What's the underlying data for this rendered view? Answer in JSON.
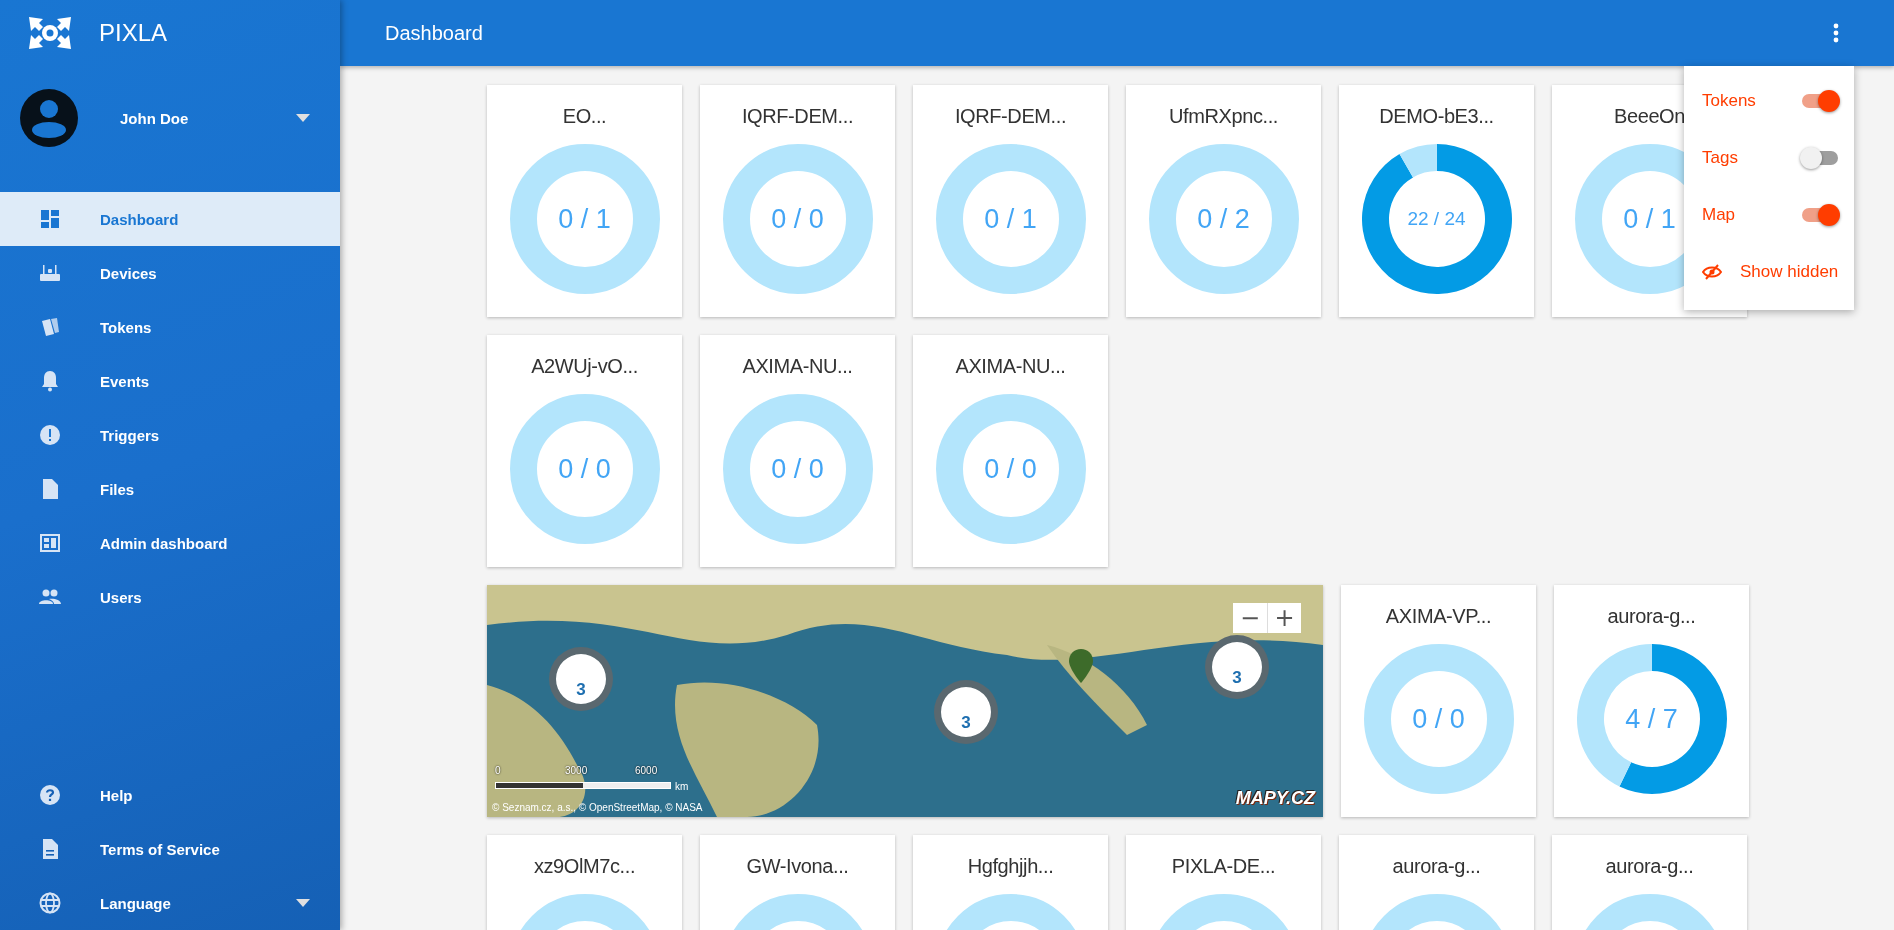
{
  "app": {
    "name": "PIXLA"
  },
  "header": {
    "title": "Dashboard"
  },
  "user": {
    "name": "John Doe",
    "expanded": false
  },
  "sidebar": {
    "items": [
      {
        "label": "Dashboard",
        "selected": true
      },
      {
        "label": "Devices",
        "selected": false
      },
      {
        "label": "Tokens",
        "selected": false
      },
      {
        "label": "Events",
        "selected": false
      },
      {
        "label": "Triggers",
        "selected": false
      },
      {
        "label": "Files",
        "selected": false
      },
      {
        "label": "Admin dashboard",
        "selected": false
      },
      {
        "label": "Users",
        "selected": false
      }
    ],
    "footer_items": [
      {
        "label": "Help"
      },
      {
        "label": "Terms of Service"
      },
      {
        "label": "Language",
        "expanded": false
      }
    ]
  },
  "dashboard": {
    "rows": [
      {
        "tiles": [
          {
            "kind": "gauge",
            "title": "EO...",
            "reading": "0 / 1"
          },
          {
            "kind": "gauge",
            "title": "IQRF-DEM...",
            "reading": "0 / 0"
          },
          {
            "kind": "gauge",
            "title": "IQRF-DEM...",
            "reading": "0 / 1"
          },
          {
            "kind": "gauge",
            "title": "UfmRXpnc...",
            "reading": "0 / 2"
          },
          {
            "kind": "gauge",
            "title": "DEMO-bE3...",
            "reading": "22 / 24",
            "chart_data": {
              "type": "donut",
              "values": [
                91.67,
                8.33
              ]
            }
          },
          {
            "kind": "gauge",
            "title": "BeeeOn",
            "reading": "0 / 1"
          }
        ]
      },
      {
        "tiles": [
          {
            "kind": "gauge",
            "title": "A2WUj-vO...",
            "reading": "0 / 0"
          },
          {
            "kind": "gauge",
            "title": "AXIMA-NU...",
            "reading": "0 / 0"
          },
          {
            "kind": "gauge",
            "title": "AXIMA-NU...",
            "reading": "0 / 0"
          }
        ]
      },
      {
        "tiles": [
          {
            "kind": "map",
            "zoom_out": "−",
            "zoom_in": "+",
            "clusters": [
              {
                "count": "3"
              },
              {
                "count": "3"
              },
              {
                "count": "3"
              }
            ],
            "scale": {
              "labels": [
                "0",
                "3000",
                "6000"
              ],
              "unit": "km"
            },
            "attribution": "© Seznam.cz, a.s., © OpenStreetMap, © NASA",
            "logo": "MAPY.CZ"
          },
          {
            "kind": "gauge",
            "title": "AXIMA-VP...",
            "reading": "0 / 0"
          },
          {
            "kind": "gauge",
            "title": "aurora-g...",
            "reading": "4 / 7",
            "chart_data": {
              "type": "donut",
              "values": [
                57.14,
                42.86
              ]
            }
          }
        ]
      },
      {
        "tiles": [
          {
            "kind": "gauge",
            "title": "xz9OlM7c..."
          },
          {
            "kind": "gauge",
            "title": "GW-Ivona..."
          },
          {
            "kind": "gauge",
            "title": "Hgfghjjh..."
          },
          {
            "kind": "gauge",
            "title": "PIXLA-DE..."
          },
          {
            "kind": "gauge",
            "title": "aurora-g..."
          },
          {
            "kind": "gauge",
            "title": "aurora-g..."
          }
        ]
      }
    ]
  },
  "menu": {
    "items": [
      {
        "kind": "toggle",
        "label": "Tokens",
        "on": true
      },
      {
        "kind": "toggle",
        "label": "Tags",
        "on": false
      },
      {
        "kind": "toggle",
        "label": "Map",
        "on": true
      },
      {
        "kind": "action",
        "label": "Show hidden"
      }
    ]
  }
}
